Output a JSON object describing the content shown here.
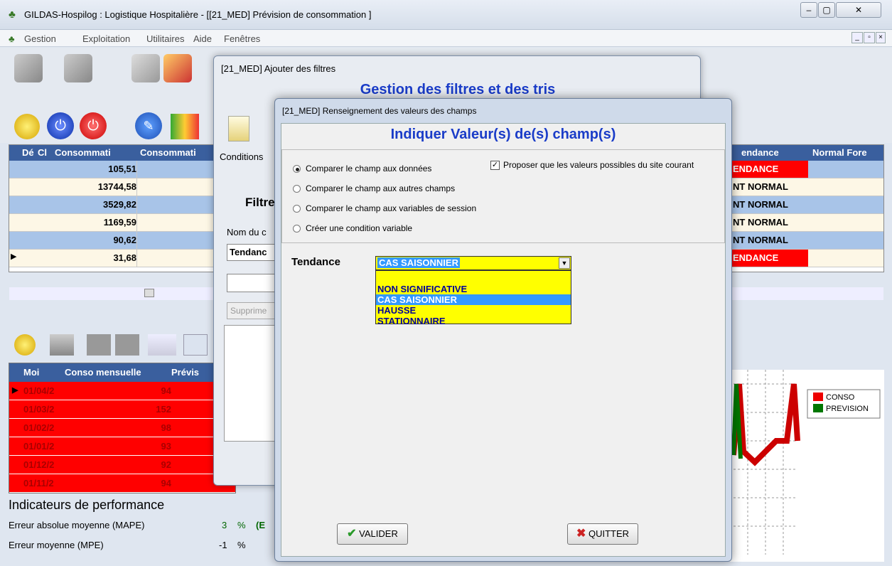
{
  "app_title": "GILDAS-Hospilog : Logistique Hospitalière - [[21_MED] Prévision de consommation ]",
  "menu": [
    "Gestion",
    "Exploitation",
    "Utilitaires",
    "Aide",
    "Fenêtres"
  ],
  "top_grid": {
    "headers": [
      "Dé",
      "Cl",
      "Consommati",
      "Consommati",
      "endance",
      "Normal Fore"
    ],
    "rows": [
      {
        "value": "105,51",
        "tendance": "ENDANCE",
        "red": true
      },
      {
        "value": "13744,58",
        "tendance": "NT NORMAL"
      },
      {
        "value": "3529,82",
        "tendance": "NT NORMAL"
      },
      {
        "value": "1169,59",
        "tendance": "NT NORMAL"
      },
      {
        "value": "90,62",
        "tendance": "NT NORMAL"
      },
      {
        "value": "31,68",
        "tendance": "ENDANCE",
        "red": true
      }
    ]
  },
  "bottom_grid": {
    "headers": [
      "Moi",
      "Conso mensuelle",
      "Prévis"
    ],
    "rows": [
      {
        "month": "01/04/2",
        "conso": "94"
      },
      {
        "month": "01/03/2",
        "conso": "152"
      },
      {
        "month": "01/02/2",
        "conso": "98"
      },
      {
        "month": "01/01/2",
        "conso": "93"
      },
      {
        "month": "01/12/2",
        "conso": "92"
      },
      {
        "month": "01/11/2",
        "conso": "94"
      }
    ]
  },
  "perf": {
    "title": "Indicateurs de performance",
    "rows": [
      {
        "label": "Erreur absolue moyenne (MAPE)",
        "value": "3",
        "unit": "%",
        "extra": "(E"
      },
      {
        "label": "Erreur moyenne (MPE)",
        "value": "-1",
        "unit": "%"
      }
    ]
  },
  "legend": [
    "CONSO",
    "PREVISION"
  ],
  "dialog_filters": {
    "title": "[21_MED] Ajouter des filtres",
    "heading": "Gestion des filtres et des tris",
    "conditions": "Conditions",
    "filtre": "Filtre",
    "nom": "Nom du c",
    "tendance_val": "Tendanc",
    "supprimer": "Supprime"
  },
  "dialog_values": {
    "title": "[21_MED] Renseignement des valeurs des champs",
    "heading": "Indiquer Valeur(s) de(s) champ(s)",
    "options": [
      "Comparer le champ aux données",
      "Comparer le champ aux autres champs",
      "Comparer le champ aux variables de session",
      "Créer une condition variable"
    ],
    "checkbox": "Proposer que les valeurs possibles du site courant",
    "field_label": "Tendance",
    "selected": "CAS SAISONNIER",
    "list": [
      "NON SIGNIFICATIVE",
      "CAS SAISONNIER",
      "HAUSSE",
      "STATIONNAIRE"
    ],
    "valider": "VALIDER",
    "quitter": "QUITTER"
  }
}
